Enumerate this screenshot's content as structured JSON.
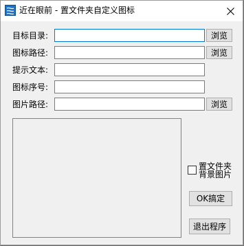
{
  "window": {
    "title": "近在眼前 - 置文件夹自定义图标",
    "icon": "app-icon",
    "close": "×"
  },
  "form": {
    "target_dir_label": "目标目录:",
    "icon_path_label": "图标路径:",
    "tip_text_label": "提示文本:",
    "icon_index_label": "图标序号:",
    "image_path_label": "图片路径:",
    "target_dir_value": "",
    "icon_path_value": "",
    "tip_text_value": "",
    "icon_index_value": "",
    "image_path_value": "",
    "browse_label": "浏览"
  },
  "options": {
    "set_bg_image_label": "置文件夹背景图片",
    "set_bg_image_checked": false
  },
  "actions": {
    "ok_label": "OK搞定",
    "exit_label": "退出程序"
  },
  "colors": {
    "accent": "#0078d7",
    "window_bg": "#f0f0f0",
    "button_bg": "#e1e1e1"
  }
}
